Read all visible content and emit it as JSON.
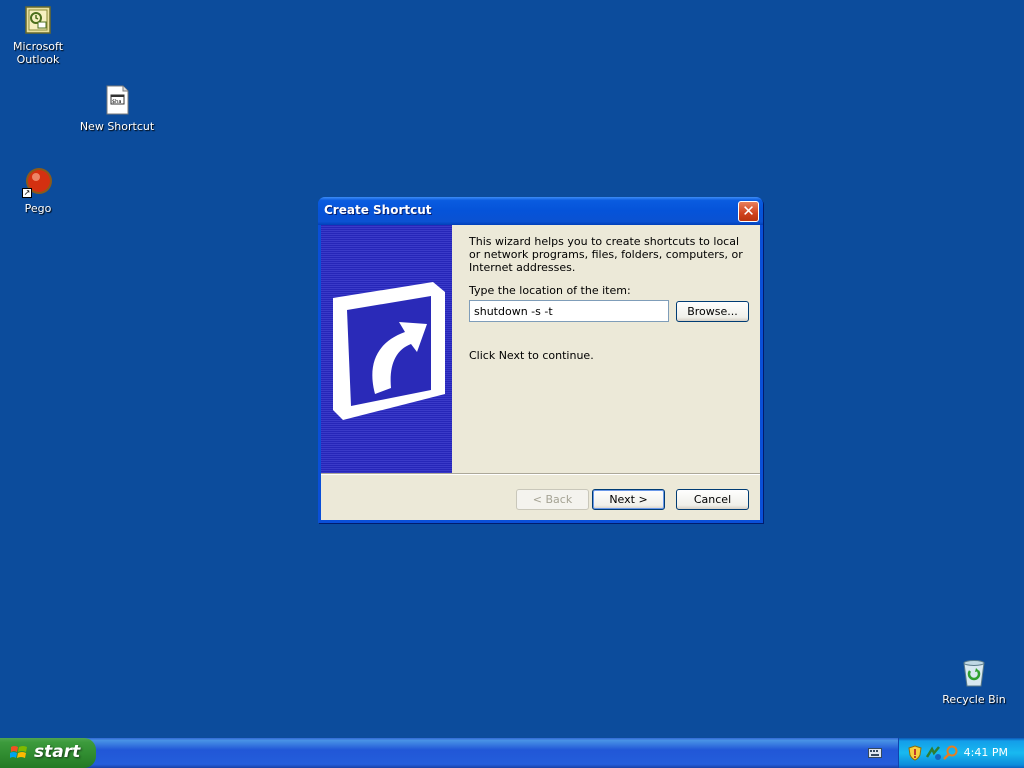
{
  "desktop": {
    "icons": [
      {
        "label": "Microsoft\nOutlook",
        "icon": "outlook-icon"
      },
      {
        "label": "New Shortcut",
        "icon": "shortcut-file-icon"
      },
      {
        "label": "Pego",
        "icon": "pego-app-icon"
      },
      {
        "label": "Recycle Bin",
        "icon": "recycle-bin-icon"
      }
    ]
  },
  "dialog": {
    "title": "Create Shortcut",
    "intro": "This wizard helps you to create shortcuts to local or network programs, files, folders, computers, or Internet addresses.",
    "location_label": "Type the location of the item:",
    "location_value": "shutdown -s -t ",
    "browse_label": "Browse...",
    "next_hint": "Click Next to continue.",
    "back_label": "< Back",
    "next_label": "Next >",
    "cancel_label": "Cancel"
  },
  "taskbar": {
    "start_label": "start",
    "clock": "4:41 PM",
    "tray_icons": [
      "keyboard-icon",
      "security-shield-icon",
      "network-icon",
      "search-icon"
    ]
  },
  "colors": {
    "desktop": "#0c4c9c",
    "titlebar": "#0553d9",
    "dialog_face": "#ece9d8",
    "start_green": "#2f8a2f"
  }
}
